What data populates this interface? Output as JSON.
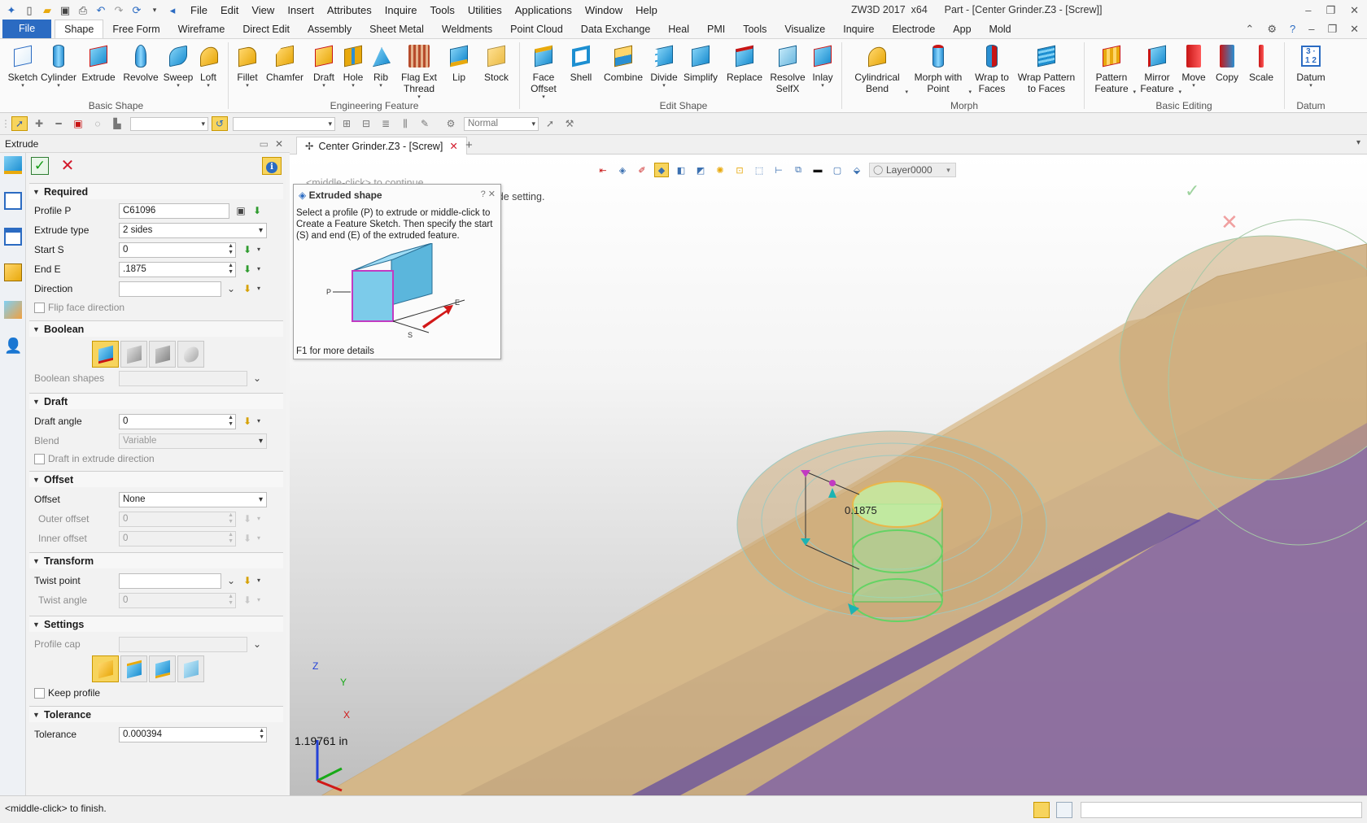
{
  "titlebar": {
    "menu": [
      "File",
      "Edit",
      "View",
      "Insert",
      "Attributes",
      "Inquire",
      "Tools",
      "Utilities",
      "Applications",
      "Window",
      "Help"
    ],
    "app_title": "ZW3D 2017  x64",
    "doc_title": "Part - [Center Grinder.Z3 - [Screw]]"
  },
  "ribbon_tabs": [
    "File",
    "Shape",
    "Free Form",
    "Wireframe",
    "Direct Edit",
    "Assembly",
    "Sheet Metal",
    "Weldments",
    "Point Cloud",
    "Data Exchange",
    "Heal",
    "PMI",
    "Tools",
    "Visualize",
    "Inquire",
    "Electrode",
    "App",
    "Mold"
  ],
  "ribbon": {
    "basic_shape": {
      "label": "Basic Shape",
      "tools": [
        "Sketch",
        "Cylinder",
        "Extrude",
        "Revolve",
        "Sweep",
        "Loft"
      ]
    },
    "engineering_feature": {
      "label": "Engineering Feature",
      "tools": [
        "Fillet",
        "Chamfer",
        "Draft",
        "Hole",
        "Rib",
        "Flag Ext Thread",
        "Lip",
        "Stock"
      ]
    },
    "edit_shape": {
      "label": "Edit Shape",
      "tools": [
        "Face Offset",
        "Shell",
        "Combine",
        "Divide",
        "Simplify",
        "Replace",
        "Resolve SelfX",
        "Inlay"
      ]
    },
    "morph": {
      "label": "Morph",
      "tools": [
        "Cylindrical Bend",
        "Morph with Point",
        "Wrap to Faces",
        "Wrap Pattern to Faces"
      ]
    },
    "basic_editing": {
      "label": "Basic Editing",
      "tools": [
        "Pattern Feature",
        "Mirror Feature",
        "Move",
        "Copy",
        "Scale"
      ]
    },
    "datum": {
      "label": "Datum",
      "tools": [
        "Datum"
      ]
    }
  },
  "toolbar2": {
    "display_mode": "Normal"
  },
  "panel": {
    "title": "Extrude",
    "sections": {
      "required": "Required",
      "boolean": "Boolean",
      "draft": "Draft",
      "offset": "Offset",
      "transform": "Transform",
      "settings": "Settings",
      "tolerance": "Tolerance"
    },
    "profile_label": "Profile P",
    "profile_value": "C61096",
    "extrude_type_label": "Extrude type",
    "extrude_type_value": "2 sides",
    "start_label": "Start S",
    "start_value": "0",
    "end_label": "End E",
    "end_value": ".1875",
    "direction_label": "Direction",
    "flip_face_label": "Flip face direction",
    "boolean_shapes_label": "Boolean shapes",
    "draft_angle_label": "Draft angle",
    "draft_angle_value": "0",
    "blend_label": "Blend",
    "blend_value": "Variable",
    "draft_in_dir_label": "Draft in extrude direction",
    "offset_label": "Offset",
    "offset_value": "None",
    "outer_offset_label": "Outer offset",
    "outer_offset_value": "0",
    "inner_offset_label": "Inner offset",
    "inner_offset_value": "0",
    "twist_point_label": "Twist point",
    "twist_angle_label": "Twist angle",
    "twist_angle_value": "0",
    "profile_cap_label": "Profile cap",
    "keep_profile_label": "Keep profile",
    "tolerance_label": "Tolerance",
    "tolerance_value": "0.000394"
  },
  "document": {
    "tab_label": "Center Grinder.Z3 - [Screw]",
    "layer": "Layer0000",
    "ghost_prompt": "<middle-click> to continue.",
    "ghost_prompt2": "> to find next valid Extrude setting.",
    "tooltip": {
      "title": "Extruded shape",
      "body": "Select a profile (P) to extrude or middle-click to Create a Feature Sketch. Then specify the start (S) and end (E) of the extruded feature.",
      "footer": "F1 for more details",
      "labels": [
        "P",
        "E",
        "S"
      ]
    },
    "dimension": "0.1875",
    "measure": "1.19761 in",
    "axes": [
      "Z",
      "Y",
      "X"
    ]
  },
  "status": {
    "message": "<middle-click> to finish."
  },
  "colors": {
    "accent": "#2b6bc2",
    "highlight": "#f7d45d",
    "part_tan": "#c9a572",
    "part_purple": "#7a5ca8",
    "selection_green": "#8fe38f"
  }
}
